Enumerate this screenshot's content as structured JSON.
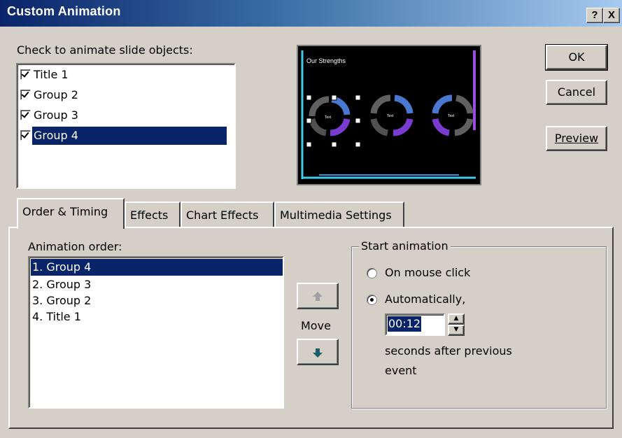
{
  "window": {
    "title": "Custom Animation",
    "help_button": "?",
    "close_button": "X"
  },
  "objects_label": "Check to animate slide objects:",
  "objects": [
    {
      "label": "Title 1",
      "checked": true
    },
    {
      "label": "Group 2",
      "checked": true
    },
    {
      "label": "Group 3",
      "checked": true
    },
    {
      "label": "Group 4",
      "checked": true,
      "selected": true
    }
  ],
  "preview": {
    "slide_title": "Our Strengths",
    "cycle_text": "Text"
  },
  "buttons": {
    "ok": "OK",
    "cancel": "Cancel",
    "preview": "Preview"
  },
  "tabs": [
    {
      "label": "Order & Timing",
      "active": true
    },
    {
      "label": "Effects"
    },
    {
      "label": "Chart Effects"
    },
    {
      "label": "Multimedia Settings"
    }
  ],
  "order": {
    "label": "Animation order:",
    "items": [
      "1. Group 4",
      "2. Group 3",
      "3. Group 2",
      "4. Title 1"
    ],
    "move_label": "Move"
  },
  "start": {
    "legend": "Start animation",
    "on_click": "On mouse click",
    "automatically": "Automatically,",
    "time_value": "00:12",
    "seconds_text_1": "seconds after previous",
    "seconds_text_2": "event"
  }
}
